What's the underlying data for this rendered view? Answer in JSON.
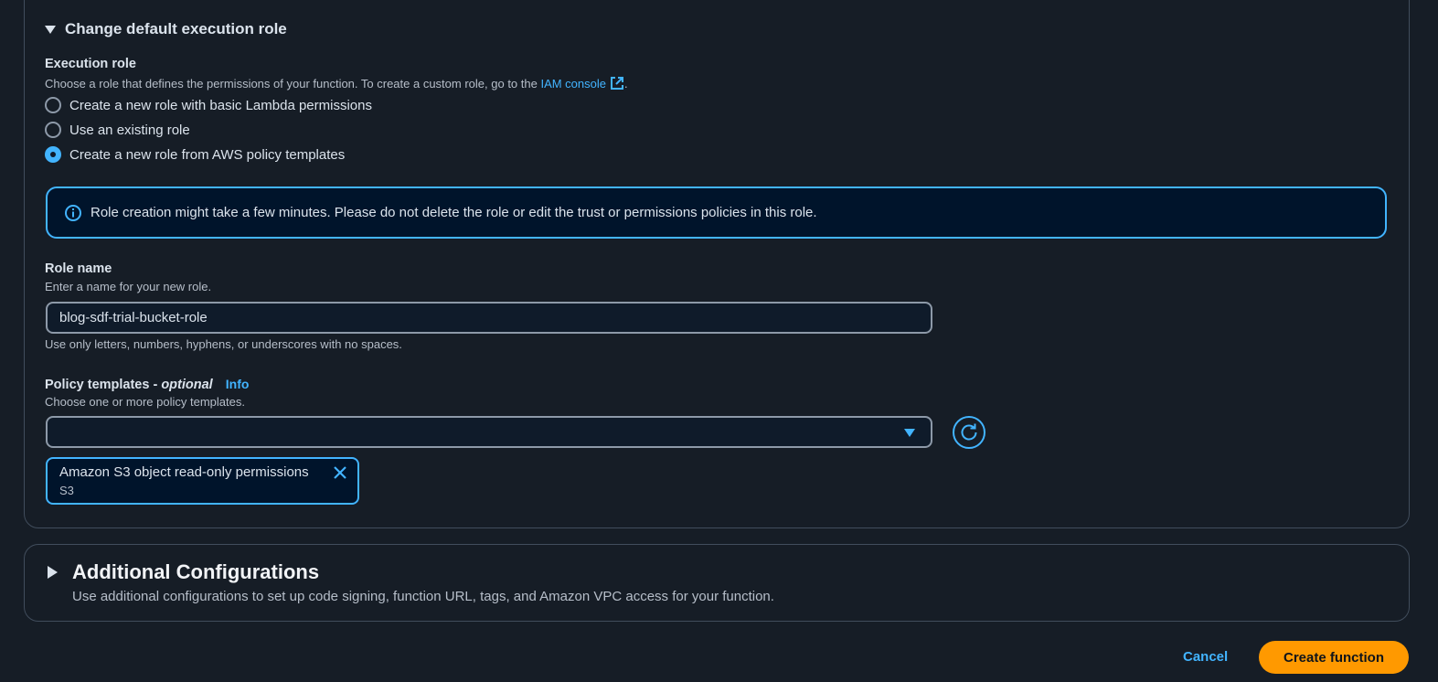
{
  "execution_role_section": {
    "expander_label": "Change default execution role",
    "label": "Execution role",
    "description_prefix": "Choose a role that defines the permissions of your function. To create a custom role, go to the ",
    "iam_link": "IAM console",
    "description_suffix": ".",
    "options": [
      {
        "label": "Create a new role with basic Lambda permissions",
        "selected": false
      },
      {
        "label": "Use an existing role",
        "selected": false
      },
      {
        "label": "Create a new role from AWS policy templates",
        "selected": true
      }
    ],
    "alert_text": "Role creation might take a few minutes. Please do not delete the role or edit the trust or permissions policies in this role.",
    "alert_icon": "info-icon"
  },
  "role_name": {
    "label": "Role name",
    "description": "Enter a name for your new role.",
    "value": "blog-sdf-trial-bucket-role",
    "constraint": "Use only letters, numbers, hyphens, or underscores with no spaces."
  },
  "policy_templates": {
    "label": "Policy templates - ",
    "label_optional": "optional",
    "info_link": "Info",
    "description": "Choose one or more policy templates.",
    "select_value": "",
    "refresh_icon": "refresh-icon",
    "selected_tokens": [
      {
        "label": "Amazon S3 object read-only permissions",
        "sublabel": "S3"
      }
    ]
  },
  "additional_configurations": {
    "title": "Additional Configurations",
    "description": "Use additional configurations to set up code signing, function URL, tags, and Amazon VPC access for your function."
  },
  "footer": {
    "cancel_label": "Cancel",
    "create_label": "Create function"
  },
  "colors": {
    "background": "#161d26",
    "accent_link": "#42b4ff",
    "primary_button": "#ff9900",
    "border": "#414d5c"
  }
}
